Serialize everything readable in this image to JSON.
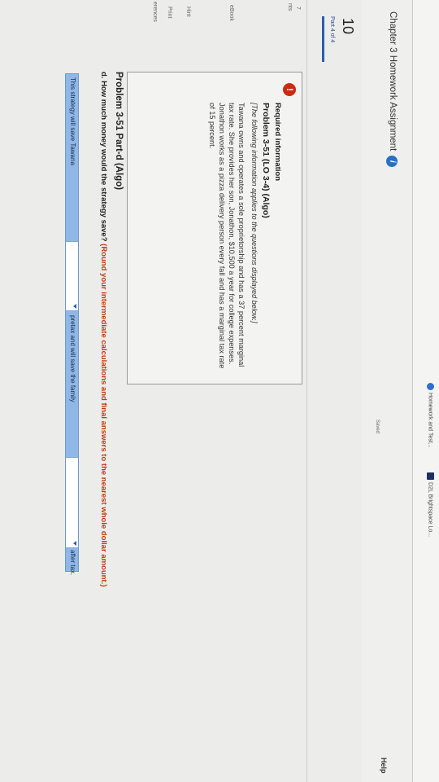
{
  "browser": {
    "bookmarks": [
      {
        "label": "Homework and Test..."
      },
      {
        "label": "D2L Brightspace Lo..."
      }
    ]
  },
  "header": {
    "title": "Chapter 3 Homework Assignment",
    "info_icon": "i",
    "saved": "Saved",
    "help": "Help"
  },
  "nav": {
    "question_number": "10",
    "part": "Part 4 of 4",
    "labels": {
      "points_a": "7",
      "points_b": "nts",
      "ebook": "eBook",
      "hint": "Hint",
      "print": "Print",
      "references": "erences"
    }
  },
  "info": {
    "alert": "!",
    "required": "Required information",
    "problem": "Problem 3-51 (LO 3-4) (Algo)",
    "intro": "[The following information applies to the questions displayed below.]",
    "body": "Tawana owns and operates a sole proprietorship and has a 37 percent marginal tax rate. She provides her son, Jonathon, $10,500 a year for college expenses. Jonathon works as a pizza delivery person every fall and has a marginal tax rate of 15 percent."
  },
  "question": {
    "title": "Problem 3-51 Part-d (Algo)",
    "prefix": "d. How much money would the strategy save?",
    "emphasis": "(Round your intermediate calculations and final answers to the nearest whole dollar amount.)"
  },
  "answer": {
    "text1": "This strategy will save Tawana",
    "text2": "pretax and will save the family",
    "text3": "after tax."
  }
}
